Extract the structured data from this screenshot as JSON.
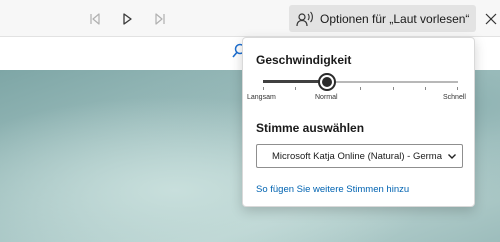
{
  "toolbar": {
    "prev_icon": "skip-previous-icon",
    "play_icon": "play-icon",
    "next_icon": "skip-next-icon",
    "options_icon": "speaker-voice-icon",
    "options_label": "Optionen für „Laut vorlesen“",
    "close_icon": "close-icon"
  },
  "page": {
    "search_icon": "search-icon"
  },
  "options_panel": {
    "speed_title": "Geschwindigkeit",
    "speed_value": "Normal",
    "speed_level": 0.3,
    "speed_min_label": "Langsam",
    "speed_mid_label": "Normal",
    "speed_max_label": "Schnell",
    "voice_title": "Stimme auswählen",
    "voice_selected": "Microsoft Katja Online (Natural) - German (Germany)",
    "voice_link": "So fügen Sie weitere Stimmen hinzu"
  },
  "colors": {
    "accent_link": "#0063b1",
    "slider_fill": "#404040",
    "toolbar_bg": "#f7f7f7"
  }
}
